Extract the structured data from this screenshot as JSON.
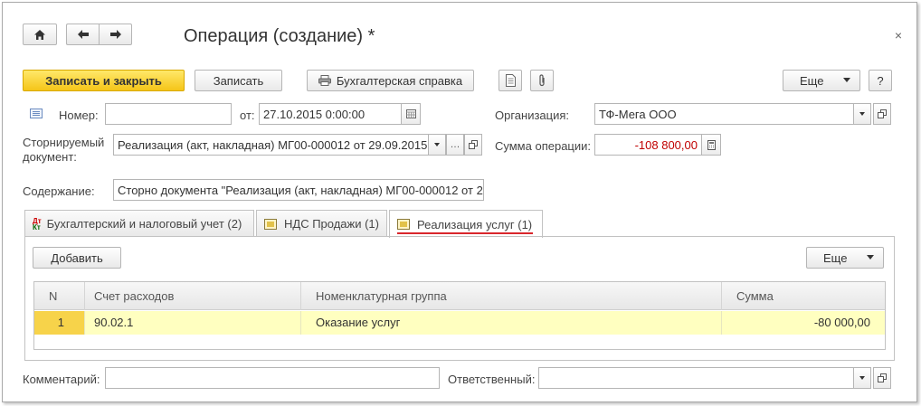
{
  "window": {
    "title": "Операция (создание) *",
    "close_glyph": "×"
  },
  "toolbar": {
    "save_close_label": "Записать и закрыть",
    "save_label": "Записать",
    "report_label": "Бухгалтерская справка",
    "more_label": "Еще",
    "help_label": "?"
  },
  "form": {
    "number_label": "Номер:",
    "number_value": "",
    "date_label": "от:",
    "date_value": "27.10.2015  0:00:00",
    "org_label": "Организация:",
    "org_value": "ТФ-Мега ООО",
    "storno_label_line1": "Сторнируемый",
    "storno_label_line2": "документ:",
    "storno_value": "Реализация (акт, накладная) МГ00-000012 от 29.09.2015",
    "sum_label": "Сумма операции:",
    "sum_value": "-108 800,00",
    "content_label": "Содержание:",
    "content_value": "Сторно документа \"Реализация (акт, накладная) МГ00-000012 от 29",
    "comment_label": "Комментарий:",
    "comment_value": "",
    "responsible_label": "Ответственный:",
    "responsible_value": ""
  },
  "tabs": [
    {
      "label": "Бухгалтерский и налоговый учет (2)",
      "active": false
    },
    {
      "label": "НДС Продажи (1)",
      "active": false
    },
    {
      "label": "Реализация услуг (1)",
      "active": true
    }
  ],
  "panel": {
    "add_label": "Добавить",
    "more_label": "Еще"
  },
  "table": {
    "columns": [
      "N",
      "Счет расходов",
      "Номенклатурная группа",
      "Сумма"
    ],
    "rows": [
      {
        "n": "1",
        "account": "90.02.1",
        "group": "Оказание услуг",
        "sum": "-80 000,00"
      }
    ]
  },
  "colors": {
    "primary_button": "#f5c518",
    "selected_row": "#ffffc0",
    "tab_underline": "#d9262c",
    "negative_sum": "#c00000"
  }
}
